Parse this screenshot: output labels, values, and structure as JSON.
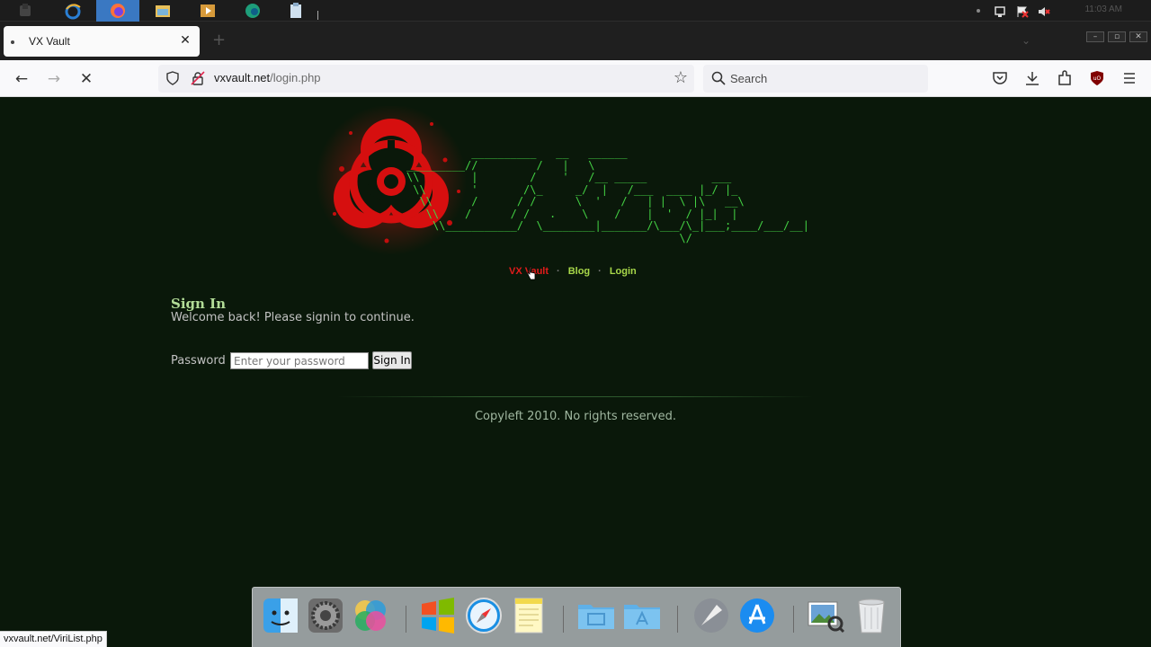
{
  "taskbar": {
    "icons": [
      "app-icon",
      "internet-explorer-icon",
      "firefox-icon",
      "file-explorer-icon",
      "media-player-icon",
      "edge-icon",
      "clipboard-icon"
    ],
    "clock": "11:03 AM"
  },
  "browser": {
    "tab": {
      "title": "VX Vault"
    },
    "url": {
      "domain": "vxvault.net",
      "path": "/login.php"
    },
    "search_placeholder": "Search"
  },
  "page": {
    "ascii_logo": "          __________   __   ______\n_________//         /   |   \\\n\\\\        |        /    '   /__ _____          ___\n \\\\       '       /\\_     _/  |   /___  ____ |_/ |_\n  \\\\      /      / /      \\  '   /   | |  \\ |\\   __\\\n   \\\\    /      / /   .    \\    /    |  '  / |_|  |\n    \\\\___________/  \\________|_______/\\___/\\_|___;____/___/__|\n                                          \\/",
    "menu": {
      "vx_vault": "VX Vault",
      "blog": "Blog",
      "login": "Login",
      "separator": "·"
    },
    "signin": {
      "heading": "Sign In",
      "subtitle": "Welcome back! Please signin to continue.",
      "password_label": "Password",
      "password_placeholder": "Enter your password",
      "button": "Sign In"
    },
    "footer": "Copyleft 2010. No rights reserved."
  },
  "dock": {
    "items": [
      "finder-icon",
      "system-preferences-icon",
      "color-sync-icon",
      "windows-icon",
      "safari-icon",
      "notes-icon",
      "folder-icon",
      "applications-folder-icon",
      "launchpad-icon",
      "app-store-icon",
      "preview-icon",
      "trash-icon"
    ]
  },
  "statusbar": {
    "link": "vxvault.net/ViriList.php"
  },
  "colors": {
    "page_bg": "#0a180a",
    "ascii_green": "#44d244",
    "menu_red": "#e31b1b",
    "menu_green": "#a8d84a",
    "heading": "#b2dc97"
  }
}
